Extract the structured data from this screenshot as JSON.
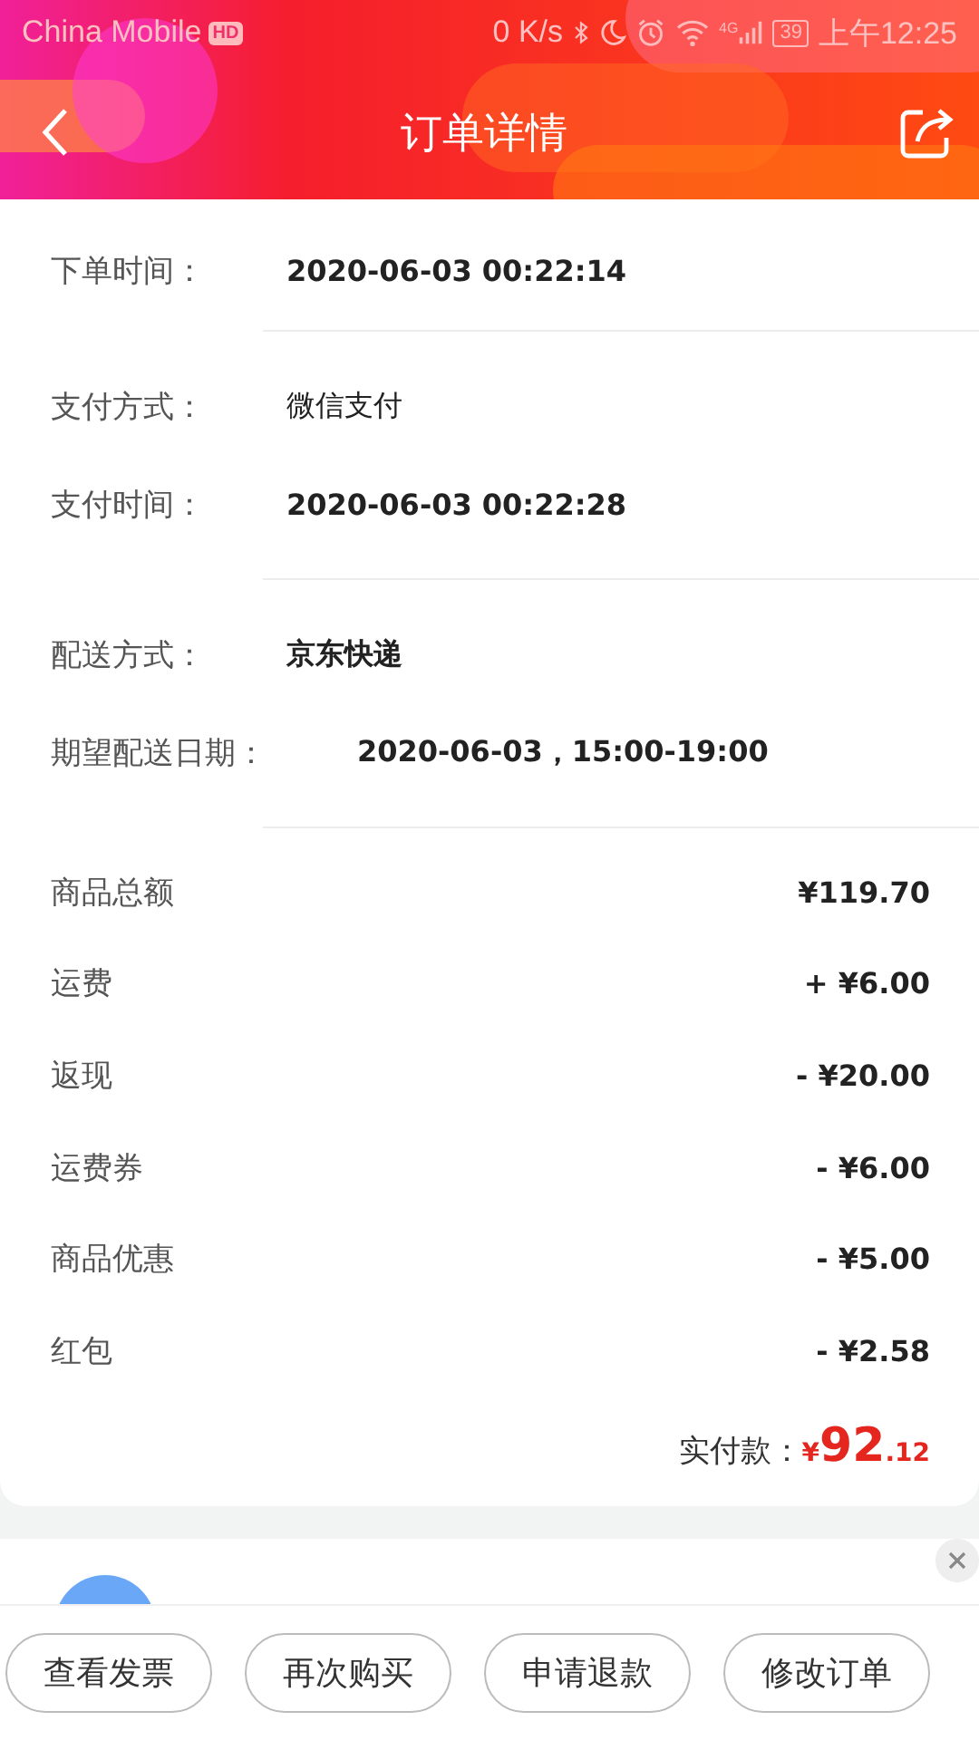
{
  "status_bar": {
    "carrier": "China Mobile",
    "hd_badge": "HD",
    "network_speed": "0 K/s",
    "network_type": "4G",
    "battery": "39",
    "time": "上午12:25"
  },
  "nav": {
    "title": "订单详情"
  },
  "info_sections": [
    [
      {
        "label": "下单时间：",
        "value": "2020-06-03 00:22:14",
        "bold": true
      }
    ],
    [
      {
        "label": "支付方式：",
        "value": "微信支付",
        "bold": false
      },
      {
        "label": "支付时间：",
        "value": "2020-06-03 00:22:28",
        "bold": true
      }
    ],
    [
      {
        "label": "配送方式：",
        "value": "京东快递",
        "bold": true
      },
      {
        "label": "期望配送日期：",
        "value": "2020-06-03，15:00-19:00",
        "bold": true
      }
    ]
  ],
  "price_rows": [
    {
      "label": "商品总额",
      "value": "¥119.70"
    },
    {
      "label": "运费",
      "value": "+ ¥6.00"
    },
    {
      "label": "返现",
      "value": "- ¥20.00"
    },
    {
      "label": "运费券",
      "value": "- ¥6.00"
    },
    {
      "label": "商品优惠",
      "value": "- ¥5.00"
    },
    {
      "label": "红包",
      "value": "- ¥2.58"
    }
  ],
  "total": {
    "label": "实付款：",
    "currency": "¥",
    "integer": "92",
    "decimal": ".12"
  },
  "actions": [
    "查看发票",
    "再次购买",
    "申请退款",
    "修改订单"
  ]
}
